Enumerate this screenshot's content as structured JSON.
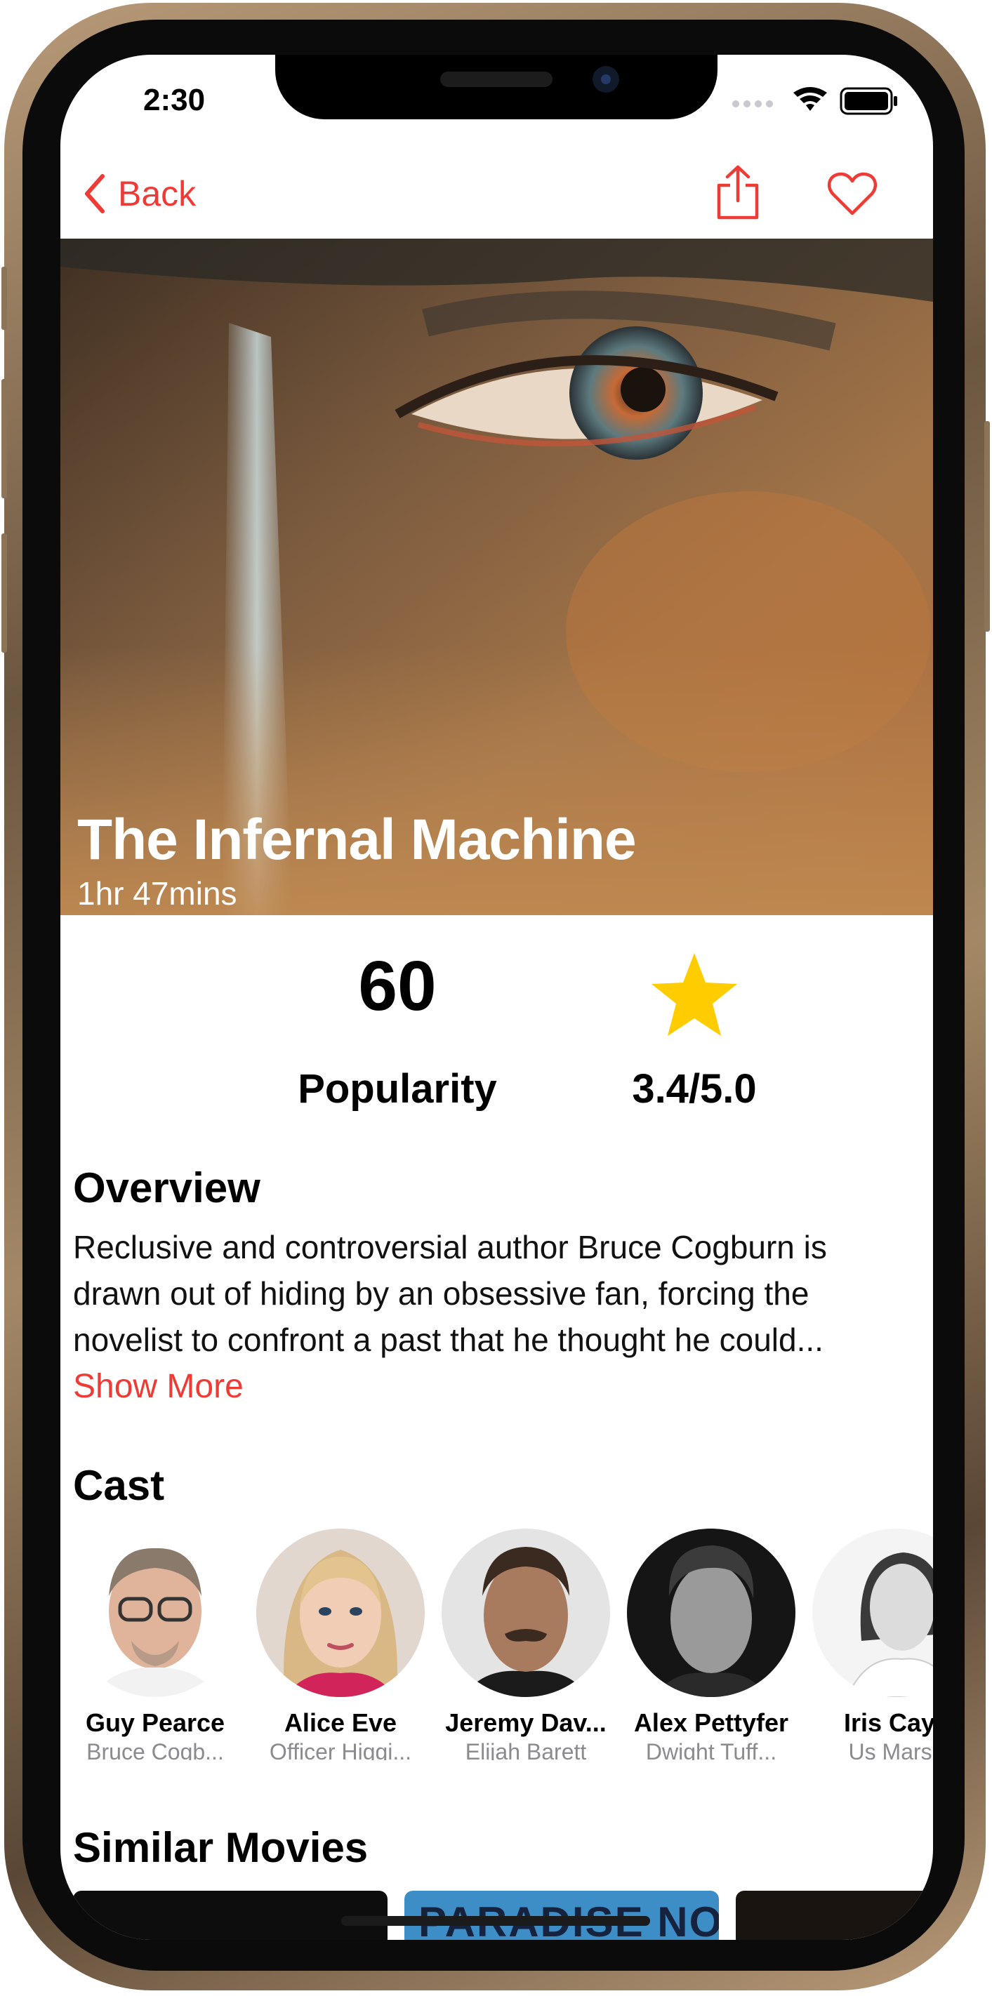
{
  "status_bar": {
    "time": "2:30"
  },
  "nav": {
    "back_label": "Back",
    "share_icon": "share-icon",
    "favorite_icon": "heart-icon"
  },
  "colors": {
    "accent": "#ef3b35",
    "star": "#ffcc00",
    "secondary_text": "#8a8a8f"
  },
  "hero": {
    "title": "The Infernal Machine",
    "duration": "1hr 47mins"
  },
  "stats": {
    "popularity_value": "60",
    "popularity_label": "Popularity",
    "rating": "3.4/5.0",
    "rating_icon": "star-icon"
  },
  "overview": {
    "heading": "Overview",
    "lines": [
      "Reclusive and controversial author Bruce Cogburn is",
      "drawn out of hiding by an obsessive fan, forcing the",
      "novelist to confront a past that he thought he could..."
    ],
    "show_more_label": "Show More"
  },
  "cast": {
    "heading": "Cast",
    "members": [
      {
        "name": "Guy Pearce",
        "role": "Bruce Cogb..."
      },
      {
        "name": "Alice Eve",
        "role": "Officer Higgi..."
      },
      {
        "name": "Jeremy Dav...",
        "role": "Elijah Barett"
      },
      {
        "name": "Alex Pettyfer",
        "role": "Dwight Tuff..."
      },
      {
        "name": "Iris Caya",
        "role": "Us Marsh"
      }
    ]
  },
  "similar": {
    "heading": "Similar Movies",
    "posters": [
      {
        "text": ""
      },
      {
        "text": "PARADISE NOW"
      },
      {
        "text": ""
      }
    ]
  }
}
